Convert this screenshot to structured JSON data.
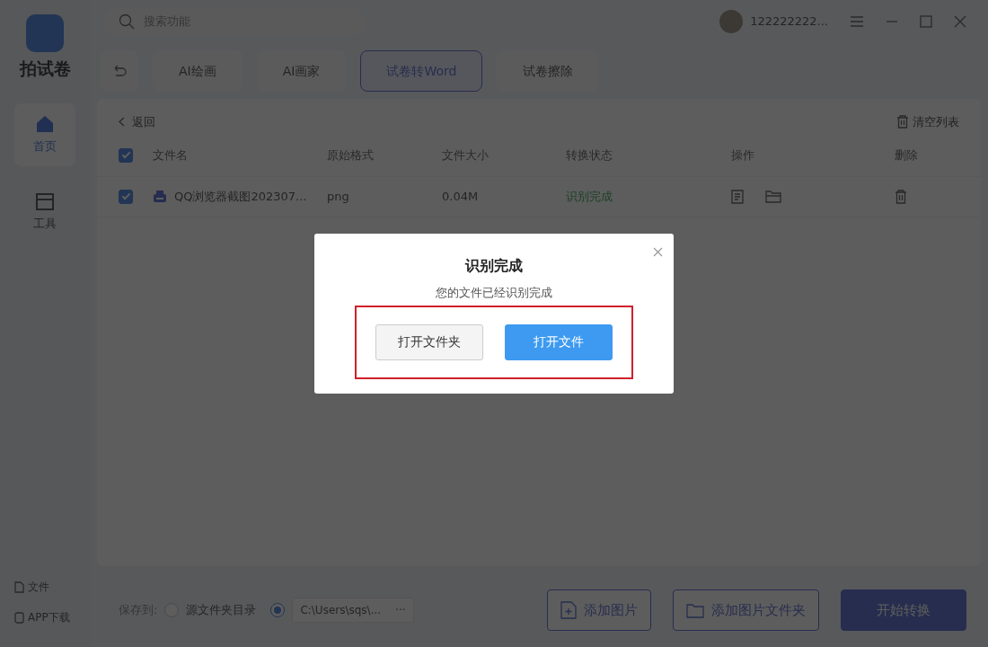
{
  "app": {
    "name": "拍试卷"
  },
  "sidebar": {
    "items": [
      {
        "label": "首页",
        "kind": "home",
        "selected": true
      },
      {
        "label": "工具",
        "kind": "tools",
        "selected": false
      }
    ],
    "links": [
      {
        "label": "文件",
        "kind": "file"
      },
      {
        "label": "APP下载",
        "kind": "phone"
      }
    ]
  },
  "search": {
    "placeholder": "搜索功能"
  },
  "user": {
    "name": "122222222..."
  },
  "tabs": [
    {
      "label": "AI绘画",
      "selected": false
    },
    {
      "label": "AI画家",
      "selected": false
    },
    {
      "label": "试卷转Word",
      "selected": true
    },
    {
      "label": "试卷擦除",
      "selected": false
    }
  ],
  "list": {
    "back": "返回",
    "clear": "清空列表",
    "all_checked": true,
    "columns": [
      "文件名",
      "原始格式",
      "文件大小",
      "转换状态",
      "操作",
      "删除"
    ],
    "rows": [
      {
        "checked": true,
        "name": "QQ浏览器截图202307...",
        "format": "png",
        "size": "0.04M",
        "status": "识别完成"
      }
    ]
  },
  "save": {
    "label": "保存到:",
    "options": [
      {
        "kind": "source",
        "label": "源文件夹目录",
        "selected": false
      },
      {
        "kind": "path",
        "label": "C:\\Users\\sqs\\...",
        "browse": "···",
        "selected": true
      }
    ]
  },
  "actions": [
    {
      "kind": "image",
      "label": "添加图片"
    },
    {
      "kind": "folder",
      "label": "添加图片文件夹"
    },
    {
      "kind": "start",
      "label": "开始转换"
    }
  ],
  "dialog": {
    "title": "识别完成",
    "message": "您的文件已经识别完成",
    "buttons": [
      {
        "kind": "secondary",
        "label": "打开文件夹"
      },
      {
        "kind": "primary",
        "label": "打开文件"
      }
    ]
  }
}
